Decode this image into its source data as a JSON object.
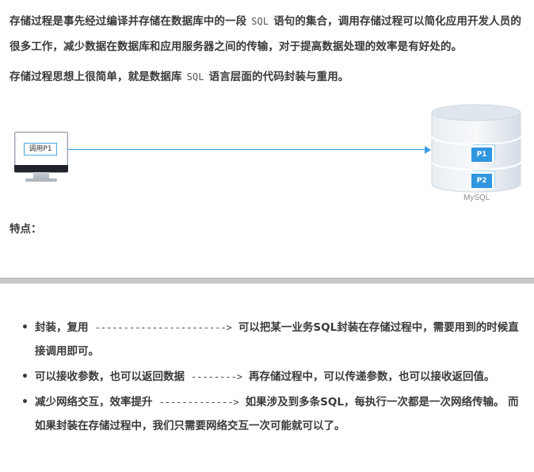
{
  "intro": {
    "p1_part1": "存储过程是事先经过编译并存储在数据库中的一段",
    "p1_code": "SQL",
    "p1_part2": "语句的集合，调用存储过程可以简化应用开发人员的很多工作，减少数据在数据库和应用服务器之间的传输，对于提高数据处理的效率是有好处的。",
    "p2_part1": "存储过程思想上很简单，就是数据库",
    "p2_code": "SQL",
    "p2_part2": "语言层面的代码封装与重用。"
  },
  "diagram": {
    "client_label": "调用P1",
    "procedures": [
      "P1",
      "P2"
    ],
    "db_label": "MySQL",
    "colors": {
      "arrow": "#3aa0e0",
      "db_body": "#dfe6ee",
      "card": "#2f96e0"
    }
  },
  "features_heading": "特点：",
  "features": [
    {
      "title": "封装，复用",
      "arrow": "----------------------->",
      "desc": "可以把某一业务SQL封装在存储过程中，需要用到的时候直接调用即可。"
    },
    {
      "title": "可以接收参数，也可以返回数据",
      "arrow": "-------->",
      "desc": "再存储过程中，可以传递参数，也可以接收返回值。"
    },
    {
      "title": "减少网络交互，效率提升",
      "arrow": "------------->",
      "desc": "如果涉及到多条SQL，每执行一次都是一次网络传输。 而如果封装在存储过程中，我们只需要网络交互一次可能就可以了。"
    }
  ]
}
